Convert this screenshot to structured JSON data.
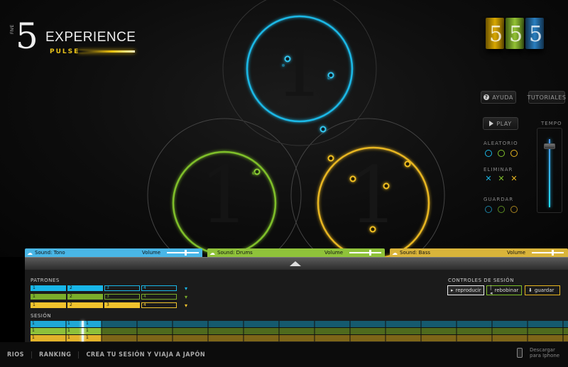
{
  "brand": {
    "five": "5",
    "five_small": "FIVE",
    "experience": "EXPERIENCE",
    "pulse": "PULSE"
  },
  "packs": [
    {
      "color": "#d8a800"
    },
    {
      "color": "#93c234"
    },
    {
      "color": "#2a7fc0"
    }
  ],
  "right_panel": {
    "help_label": "AYUDA",
    "tutorials_label": "TUTORIALES",
    "play_label": "PLAY",
    "tempo_label": "TEMPO",
    "random_label": "ALEATORIO",
    "delete_label": "ELIMINAR",
    "save_label": "GUARDAR"
  },
  "circle_numbers": {
    "blue": "1",
    "green": "1",
    "yellow": "1"
  },
  "sounds": [
    {
      "label": "Sound: Tono",
      "volume_label": "Volume",
      "color": "#49b6e6"
    },
    {
      "label": "Sound: Drums",
      "volume_label": "Volume",
      "color": "#8fc23a"
    },
    {
      "label": "Sound: Bass",
      "volume_label": "Volume",
      "color": "#d9b43a"
    }
  ],
  "patterns": {
    "title": "PATRONES",
    "rows": [
      {
        "cells": [
          "1",
          "2",
          "3",
          "4"
        ],
        "color": "#18b6e8"
      },
      {
        "cells": [
          "1",
          "2",
          "3",
          "4"
        ],
        "color": "#7aad2a"
      },
      {
        "cells": [
          "1",
          "2",
          "3",
          "4"
        ],
        "color": "#f0c22d"
      }
    ]
  },
  "session_controls": {
    "title": "CONTROLES DE SESIÓN",
    "play": "reproducir",
    "rewind": "rebobinar",
    "save": "guardar"
  },
  "session": {
    "title": "SESIÓN",
    "rows": [
      {
        "color": "#1f93b8",
        "bg": "#155a6e",
        "cells": [
          "1",
          "1",
          "1"
        ]
      },
      {
        "color": "#7aad2a",
        "bg": "#4f6a1d",
        "cells": [
          "1",
          "1",
          "1"
        ]
      },
      {
        "color": "#e2b22a",
        "bg": "#7d6518",
        "cells": [
          "1",
          "1",
          "1"
        ]
      }
    ]
  },
  "nav": {
    "items": [
      "RIOS",
      "RANKING",
      "CREA TU SESIÓN Y VIAJA A JAPÓN"
    ],
    "download": [
      "Descargar",
      "para Iphone"
    ]
  }
}
